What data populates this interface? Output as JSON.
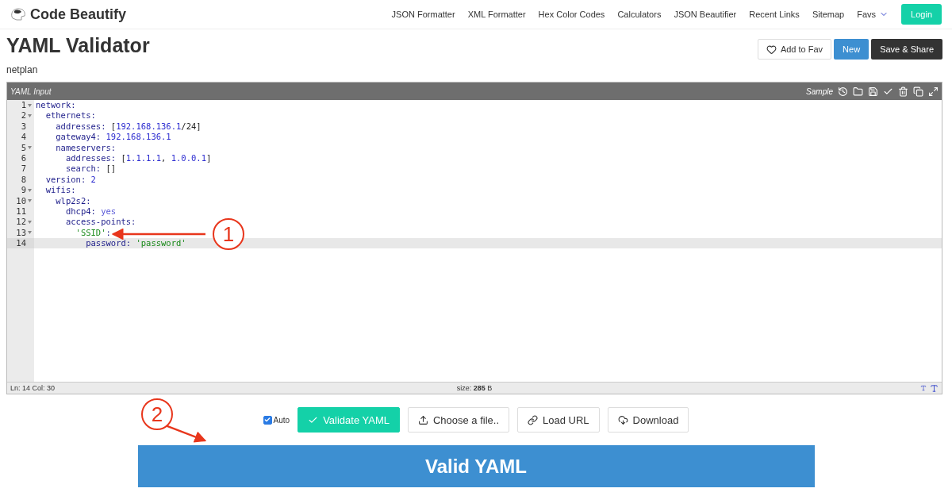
{
  "brand": "Code Beautify",
  "nav": [
    {
      "label": "JSON Formatter"
    },
    {
      "label": "XML Formatter"
    },
    {
      "label": "Hex Color Codes"
    },
    {
      "label": "Calculators"
    },
    {
      "label": "JSON Beautifier"
    },
    {
      "label": "Recent Links"
    },
    {
      "label": "Sitemap"
    },
    {
      "label": "Favs",
      "kind": "dropdown"
    }
  ],
  "login": "Login",
  "title": "YAML Validator",
  "subtitle": "netplan",
  "actions": [
    {
      "label": "Add to Fav",
      "kind": "fav"
    },
    {
      "label": "New",
      "kind": "primary"
    },
    {
      "label": "Save & Share",
      "kind": "dark"
    }
  ],
  "editor": {
    "title": "YAML Input",
    "sample": "Sample",
    "lines": [
      {
        "number": "1",
        "fold": true,
        "active": false,
        "tokens": [
          {
            "kind": "key",
            "text": "network:"
          }
        ]
      },
      {
        "number": "2",
        "fold": true,
        "active": false,
        "tokens": [
          {
            "kind": "key",
            "text": "  ethernets:"
          }
        ]
      },
      {
        "number": "3",
        "fold": false,
        "active": false,
        "tokens": [
          {
            "kind": "key",
            "text": "    addresses: "
          },
          {
            "kind": "punct",
            "text": "["
          },
          {
            "kind": "num",
            "text": "192.168.136.1"
          },
          {
            "kind": "punct",
            "text": "/24]"
          }
        ]
      },
      {
        "number": "4",
        "fold": false,
        "active": false,
        "tokens": [
          {
            "kind": "key",
            "text": "    gateway4: "
          },
          {
            "kind": "num",
            "text": "192.168.136.1"
          }
        ]
      },
      {
        "number": "5",
        "fold": true,
        "active": false,
        "tokens": [
          {
            "kind": "key",
            "text": "    nameservers:"
          }
        ]
      },
      {
        "number": "6",
        "fold": false,
        "active": false,
        "tokens": [
          {
            "kind": "key",
            "text": "      addresses: "
          },
          {
            "kind": "punct",
            "text": "["
          },
          {
            "kind": "num",
            "text": "1.1.1.1"
          },
          {
            "kind": "punct",
            "text": ", "
          },
          {
            "kind": "num",
            "text": "1.0.0.1"
          },
          {
            "kind": "punct",
            "text": "]"
          }
        ]
      },
      {
        "number": "7",
        "fold": false,
        "active": false,
        "tokens": [
          {
            "kind": "key",
            "text": "      search: "
          },
          {
            "kind": "punct",
            "text": "[]"
          }
        ]
      },
      {
        "number": "8",
        "fold": false,
        "active": false,
        "tokens": [
          {
            "kind": "key",
            "text": "  version: "
          },
          {
            "kind": "num",
            "text": "2"
          }
        ]
      },
      {
        "number": "9",
        "fold": true,
        "active": false,
        "tokens": [
          {
            "kind": "key",
            "text": "  wifis:"
          }
        ]
      },
      {
        "number": "10",
        "fold": true,
        "active": false,
        "tokens": [
          {
            "kind": "key",
            "text": "    wlp2s2:"
          }
        ]
      },
      {
        "number": "11",
        "fold": false,
        "active": false,
        "tokens": [
          {
            "kind": "key",
            "text": "      dhcp4: "
          },
          {
            "kind": "bool",
            "text": "yes"
          }
        ]
      },
      {
        "number": "12",
        "fold": true,
        "active": false,
        "tokens": [
          {
            "kind": "key",
            "text": "      access-points:"
          }
        ]
      },
      {
        "number": "13",
        "fold": true,
        "active": false,
        "tokens": [
          {
            "kind": "str",
            "text": "        'SSID'"
          },
          {
            "kind": "key",
            "text": ":"
          }
        ]
      },
      {
        "number": "14",
        "fold": false,
        "active": true,
        "tokens": [
          {
            "kind": "key",
            "text": "          password: "
          },
          {
            "kind": "str",
            "text": "'password'"
          }
        ]
      }
    ],
    "position": "Ln: 14 Col: 30",
    "size": "size: **285** B"
  },
  "auto": {
    "label": "Auto",
    "checked": true
  },
  "buttons": [
    {
      "label": "Validate YAML",
      "kind": "validate"
    },
    {
      "label": "Choose a file..",
      "kind": "upload"
    },
    {
      "label": "Load URL",
      "kind": "link"
    },
    {
      "label": "Download",
      "kind": "download"
    }
  ],
  "result": "Valid YAML",
  "annotations": [
    {
      "label": "1"
    },
    {
      "label": "2"
    }
  ]
}
